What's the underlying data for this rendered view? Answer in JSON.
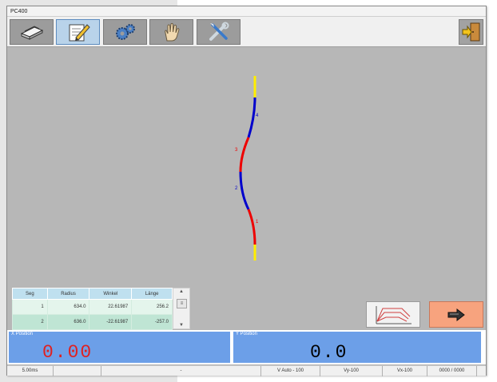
{
  "window": {
    "title": "PC400"
  },
  "toolbar": {
    "buttons": [
      {
        "name": "files",
        "icon": "folder-stack-icon"
      },
      {
        "name": "edit",
        "icon": "pencil-icon",
        "active": true
      },
      {
        "name": "settings",
        "icon": "gears-icon"
      },
      {
        "name": "manual",
        "icon": "hand-icon"
      },
      {
        "name": "tools",
        "icon": "tools-icon"
      }
    ],
    "exit_icon": "exit-door-icon"
  },
  "drawing": {
    "segment_labels": [
      "1",
      "2",
      "3",
      "4"
    ]
  },
  "segment_table": {
    "headers": [
      "Seg",
      "Radius",
      "Winkel",
      "Länge"
    ],
    "rows": [
      [
        "1",
        "634.0",
        "22.61987",
        "256.2"
      ],
      [
        "2",
        "636.0",
        "-22.61987",
        "-257.0"
      ]
    ]
  },
  "position": {
    "x_label": "X Position",
    "x_value": "0.00",
    "y_label": "Y Position",
    "y_value": "0.0"
  },
  "status": {
    "time": "5.00ms",
    "field2": "",
    "field3": "-",
    "v_auto": "V Auto - 100",
    "vy": "Vy-100",
    "vx": "Vx-100",
    "counter": "0000 / 0000"
  },
  "colors": {
    "x_value": "#e02020",
    "y_value": "#000000",
    "next_button": "#f7a37e",
    "curve_red": "#ee0000",
    "curve_blue": "#0000cc",
    "curve_yellow": "#ffee00"
  }
}
